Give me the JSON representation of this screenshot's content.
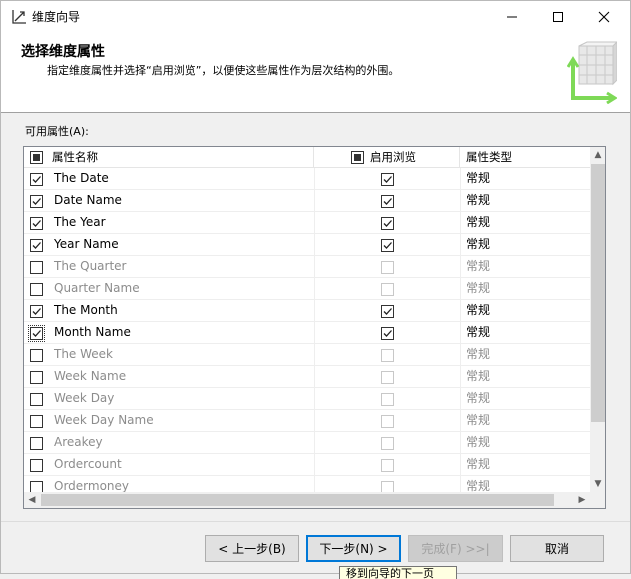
{
  "window": {
    "title": "维度向导"
  },
  "header": {
    "title": "选择维度属性",
    "description": "指定维度属性并选择“启用浏览”，以便使这些属性作为层次结构的外围。"
  },
  "list": {
    "label": "可用属性(A):",
    "columns": {
      "name": "属性名称",
      "browse": "启用浏览",
      "type": "属性类型"
    },
    "header_checkbox_state": "indeterminate",
    "header_browse_checkbox_state": "indeterminate",
    "rows": [
      {
        "name": "The Date",
        "checked": true,
        "browse": true,
        "type": "常规"
      },
      {
        "name": "Date Name",
        "checked": true,
        "browse": true,
        "type": "常规"
      },
      {
        "name": "The Year",
        "checked": true,
        "browse": true,
        "type": "常规"
      },
      {
        "name": "Year Name",
        "checked": true,
        "browse": true,
        "type": "常规"
      },
      {
        "name": "The Quarter",
        "checked": false,
        "browse": false,
        "type": "常规"
      },
      {
        "name": "Quarter Name",
        "checked": false,
        "browse": false,
        "type": "常规"
      },
      {
        "name": "The Month",
        "checked": true,
        "browse": true,
        "type": "常规"
      },
      {
        "name": "Month Name",
        "checked": true,
        "browse": true,
        "type": "常规",
        "focused": true
      },
      {
        "name": "The Week",
        "checked": false,
        "browse": false,
        "type": "常规"
      },
      {
        "name": "Week Name",
        "checked": false,
        "browse": false,
        "type": "常规"
      },
      {
        "name": "Week Day",
        "checked": false,
        "browse": false,
        "type": "常规"
      },
      {
        "name": "Week Day Name",
        "checked": false,
        "browse": false,
        "type": "常规"
      },
      {
        "name": "Areakey",
        "checked": false,
        "browse": false,
        "type": "常规"
      },
      {
        "name": "Ordercount",
        "checked": false,
        "browse": false,
        "type": "常规"
      },
      {
        "name": "Ordermoney",
        "checked": false,
        "browse": false,
        "type": "常规"
      }
    ]
  },
  "buttons": {
    "back": "< 上一步(B)",
    "next": "下一步(N) >",
    "finish": "完成(F) >>|",
    "cancel": "取消"
  },
  "tooltip": {
    "text": "移到向导的下一页"
  },
  "colors": {
    "accent": "#0078d7",
    "disabled_text": "#8c8c8c",
    "graphic_green": "#7ed957"
  }
}
